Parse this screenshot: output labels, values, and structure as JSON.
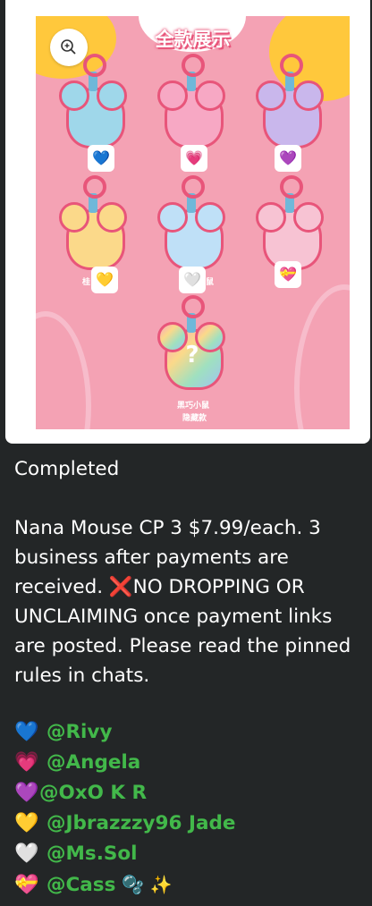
{
  "poster": {
    "title": "全款展示",
    "zoom_icon": "zoom-in-icon",
    "figures": [
      {
        "color": "#9fd7ea",
        "badge": "💙",
        "caption": ""
      },
      {
        "color": "#f7a8c4",
        "badge": "💗",
        "caption": ""
      },
      {
        "color": "#c9b7ec",
        "badge": "💜",
        "caption": ""
      },
      {
        "color": "#fbd98a",
        "badge": "💛",
        "caption": "桂"
      },
      {
        "color": "#bfe0f7",
        "badge": "🤍",
        "caption": "鼠"
      },
      {
        "color": "#f7c3d3",
        "badge": "💝",
        "caption": ""
      }
    ],
    "secret": {
      "mark": "?",
      "caption_line1": "黑巧小鼠",
      "caption_line2": "隐藏款"
    }
  },
  "message": {
    "status": "Completed",
    "para_before_cross": "Nana Mouse CP 3 $7.99/each. 3 business after payments are received. ",
    "cross": "❌",
    "para_after_cross": "NO DROPPING OR UNCLAIMING once payment links are posted. Please read the pinned rules in chats."
  },
  "claims": [
    {
      "emoji": "💙",
      "mention": "@Rivy",
      "extra": ""
    },
    {
      "emoji": "💗",
      "mention": "@Angela",
      "extra": ""
    },
    {
      "emoji": "💜",
      "mention": "@OxO K R",
      "extra": ""
    },
    {
      "emoji": "💛",
      "mention": "@Jbrazzzy96 Jade",
      "extra": ""
    },
    {
      "emoji": "🤍",
      "mention": "@Ms.Sol",
      "extra": ""
    },
    {
      "emoji": "💝",
      "mention": "@Cass",
      "extra": "🫧 ✨"
    }
  ]
}
